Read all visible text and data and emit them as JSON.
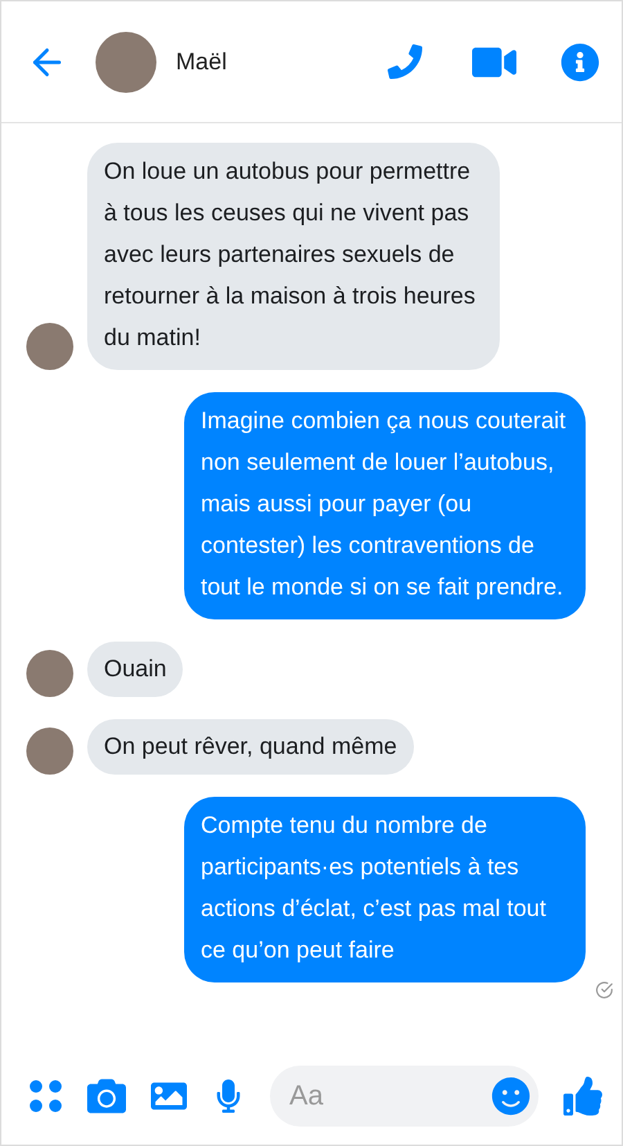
{
  "header": {
    "contact_name": "Maël"
  },
  "messages": [
    {
      "kind": "received",
      "text": "On loue un autobus pour permettre à tous les ceuses qui ne vivent pas avec leurs partenaires sexuels de retourner à la maison à trois heures du matin!",
      "delivered": false
    },
    {
      "kind": "sent",
      "text": "Imagine combien ça nous couterait non seulement de louer l’autobus, mais aussi pour payer (ou contester) les contraventions de tout le monde si on se fait prendre.",
      "delivered": false
    },
    {
      "kind": "received",
      "text": "Ouain",
      "delivered": false
    },
    {
      "kind": "received",
      "text": "On peut rêver, quand même",
      "delivered": false
    },
    {
      "kind": "sent",
      "text": "Compte tenu du nombre de participants·es potentiels à tes actions d’éclat, c’est pas mal tout ce qu’on peut faire",
      "delivered": true
    }
  ],
  "composer": {
    "placeholder": "Aa"
  }
}
